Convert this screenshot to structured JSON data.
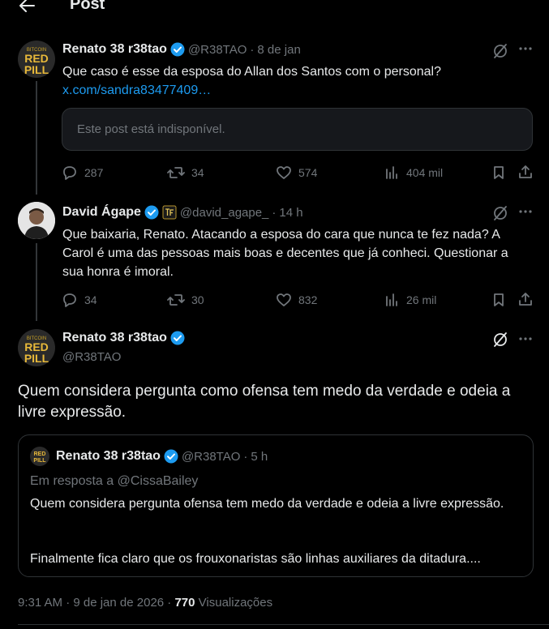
{
  "header": {
    "title": "Post"
  },
  "avatar_text": {
    "top": "BITCOIN",
    "line1": "RED",
    "line2": "PILL"
  },
  "tweet1": {
    "name": "Renato 38 r38tao",
    "handle": "@R38TAO",
    "sep": "·",
    "date": "8 de jan",
    "text": "Que caso é esse da esposa do Allan dos Santos com o personal?",
    "link": "x.com/sandra83477409…",
    "unavailable": "Este post está indisponível.",
    "replies": "287",
    "reposts": "34",
    "likes": "574",
    "views": "404 mil"
  },
  "tweet2": {
    "name": "David Ágape",
    "handle": "@david_agape_",
    "sep": "·",
    "date": "14 h",
    "text": "Que baixaria, Renato. Atacando a esposa do cara que nunca te fez nada? A Carol é uma das pessoas mais boas e decentes que já conheci. Questionar a sua honra é imoral.",
    "replies": "34",
    "reposts": "30",
    "likes": "832",
    "views": "26 mil"
  },
  "main": {
    "name": "Renato 38 r38tao",
    "handle": "@R38TAO",
    "text": "Quem considera pergunta como ofensa tem medo da verdade e odeia a livre expressão.",
    "timestamp": "9:31 AM · 9 de jan de 2026 · ",
    "view_count": "770",
    "views_label": " Visualizações"
  },
  "quote": {
    "name": "Renato 38 r38tao",
    "handle": "@R38TAO",
    "sep": "·",
    "date": "5 h",
    "in_reply": "Em resposta a @CissaBailey",
    "text1": "Quem considera pergunta ofensa tem medo da verdade e odeia a livre expressão.",
    "text2": "Finalmente fica claro que os frouxonaristas são linhas auxiliares da ditadura...."
  },
  "colors": {
    "background": "#000000",
    "text": "#e7e9ea",
    "muted": "#71767b",
    "verified": "#1d9bf0",
    "link": "#1d9bf0",
    "border": "#2f3336"
  }
}
